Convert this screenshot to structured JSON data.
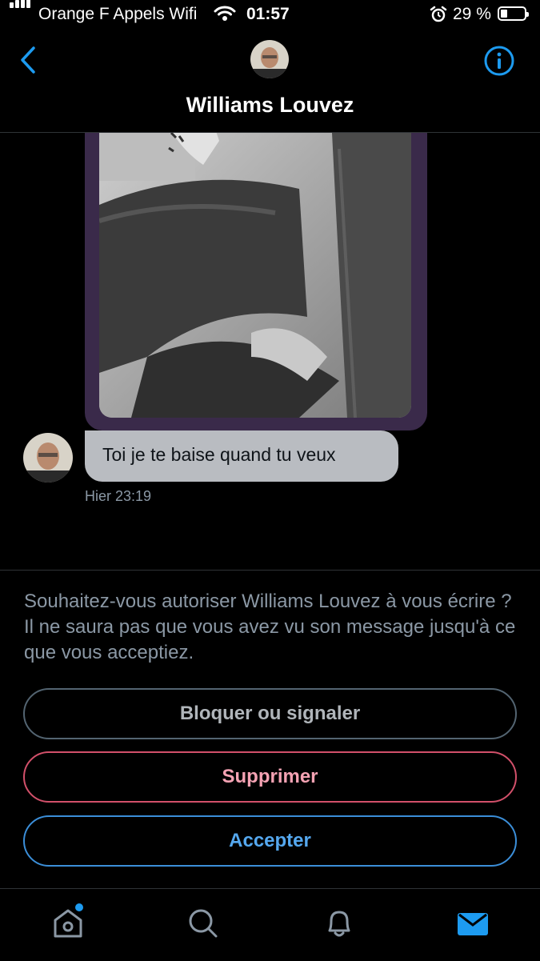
{
  "status_bar": {
    "carrier": "Orange F Appels Wifi",
    "time": "01:57",
    "battery_text": "29 %",
    "battery_level": 0.29,
    "icons": [
      "signal-icon",
      "wifi-icon",
      "alarm-icon",
      "battery-icon"
    ]
  },
  "header": {
    "title": "Williams Louvez",
    "back_icon": "chevron-left-icon",
    "info_icon": "info-icon",
    "accent_color": "#1d9bf0"
  },
  "conversation": {
    "messages": [
      {
        "sender": "Williams Louvez",
        "type": "image",
        "image_desc_icon": "photo-icon"
      },
      {
        "sender": "Williams Louvez",
        "type": "text",
        "text": "Toi je te baise quand tu veux",
        "timestamp": "Hier 23:19"
      }
    ]
  },
  "request": {
    "prompt": "Souhaitez-vous autoriser Williams Louvez à vous écrire ? Il ne saura pas que vous avez vu son message jusqu'à ce que vous acceptiez.",
    "block_label": "Bloquer ou signaler",
    "delete_label": "Supprimer",
    "accept_label": "Accepter",
    "colors": {
      "delete": "#f4a2b3",
      "accept": "#55a8ef"
    }
  },
  "tab_bar": {
    "tabs": [
      "home-icon",
      "search-icon",
      "notifications-icon",
      "messages-icon"
    ],
    "active": "messages-icon",
    "active_color": "#1d9bf0"
  }
}
